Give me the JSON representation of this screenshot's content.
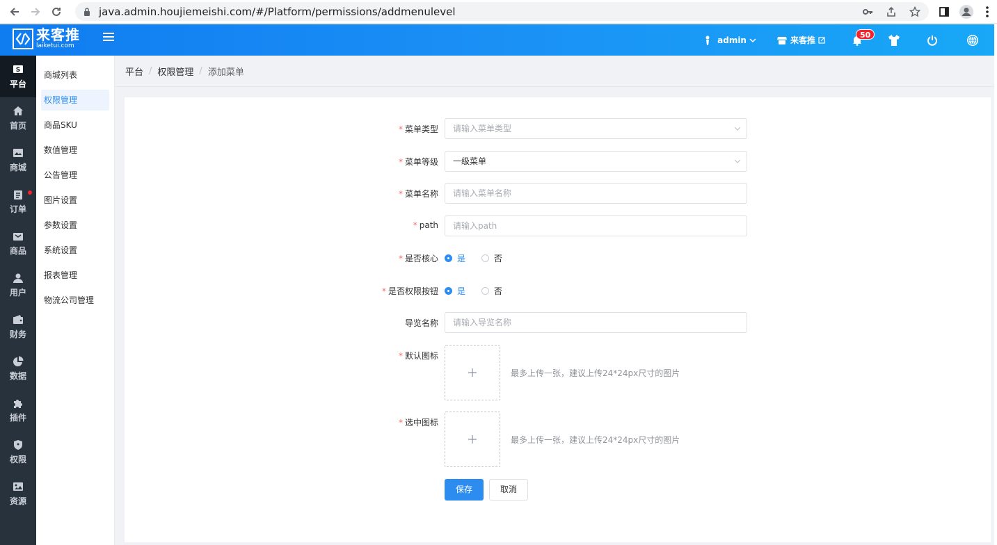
{
  "browser": {
    "url": "java.admin.houjiemeishi.com/#/Platform/permissions/addmenulevel"
  },
  "header": {
    "logo_cn": "来客推",
    "logo_en": "laiketui.com",
    "user": "admin",
    "store": "来客推",
    "notification_count": "50"
  },
  "sidebar": {
    "items": [
      {
        "label": "平台",
        "icon": "platform-icon",
        "active": true
      },
      {
        "label": "首页",
        "icon": "home-icon"
      },
      {
        "label": "商城",
        "icon": "mall-icon"
      },
      {
        "label": "订单",
        "icon": "order-icon",
        "dot": true
      },
      {
        "label": "商品",
        "icon": "product-icon"
      },
      {
        "label": "用户",
        "icon": "user-icon"
      },
      {
        "label": "财务",
        "icon": "wallet-icon"
      },
      {
        "label": "数据",
        "icon": "chart-icon"
      },
      {
        "label": "插件",
        "icon": "puzzle-icon"
      },
      {
        "label": "权限",
        "icon": "shield-icon"
      },
      {
        "label": "资源",
        "icon": "image-icon"
      }
    ]
  },
  "subnav": {
    "items": [
      "商城列表",
      "权限管理",
      "商品SKU",
      "数值管理",
      "公告管理",
      "图片设置",
      "参数设置",
      "系统设置",
      "报表管理",
      "物流公司管理"
    ],
    "active_index": 1
  },
  "breadcrumb": [
    "平台",
    "权限管理",
    "添加菜单"
  ],
  "form": {
    "menu_type": {
      "label": "菜单类型",
      "placeholder": "请输入菜单类型"
    },
    "menu_level": {
      "label": "菜单等级",
      "value": "一级菜单"
    },
    "menu_name": {
      "label": "菜单名称",
      "placeholder": "请输入菜单名称"
    },
    "path": {
      "label": "path",
      "placeholder": "请输入path"
    },
    "is_core": {
      "label": "是否核心",
      "yes": "是",
      "no": "否",
      "selected": "是"
    },
    "is_permission_button": {
      "label": "是否权限按钮",
      "yes": "是",
      "no": "否",
      "selected": "是"
    },
    "guide_name": {
      "label": "导览名称",
      "placeholder": "请输入导览名称"
    },
    "default_icon": {
      "label": "默认图标",
      "hint": "最多上传一张，建议上传24*24px尺寸的图片"
    },
    "selected_icon": {
      "label": "选中图标",
      "hint": "最多上传一张，建议上传24*24px尺寸的图片"
    },
    "save_label": "保存",
    "cancel_label": "取消"
  },
  "colors": {
    "accent": "#2d8cf0",
    "header_start": "#0f7cf0",
    "header_end": "#18a8f7",
    "sidebar_dark": "#28323d",
    "required": "#f56c6c"
  }
}
